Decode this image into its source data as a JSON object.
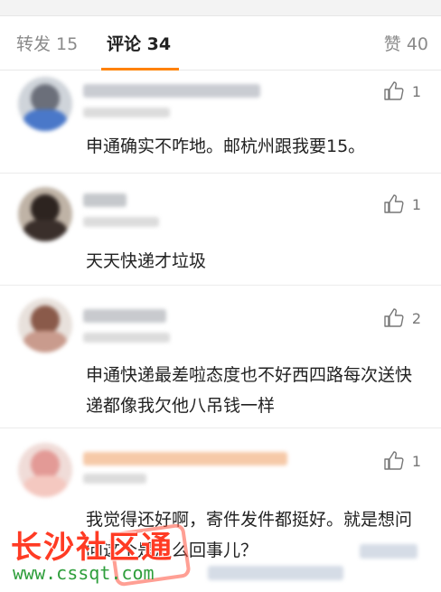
{
  "tabs": {
    "repost": "转发 15",
    "comment": "评论 34",
    "like": "赞 40"
  },
  "comments": [
    {
      "likes": "1",
      "text": "申通确实不咋地。邮杭州跟我要15。"
    },
    {
      "likes": "1",
      "text": "天天快递才垃圾"
    },
    {
      "likes": "2",
      "text": "申通快递最差啦态度也不好西四路每次送快递都像我欠他八吊钱一样"
    },
    {
      "likes": "1",
      "text": "我觉得还好啊，寄件发件都挺好。就是想问问这个是怎么回事儿？"
    }
  ],
  "watermark": {
    "title": "长沙社区通",
    "url": "www.cssqt.com"
  },
  "colors": {
    "accent": "#ff8200",
    "watermark_red": "#ff3b24",
    "watermark_green": "#2e9e3b"
  },
  "icons": {
    "like": "thumbs-up-icon"
  }
}
